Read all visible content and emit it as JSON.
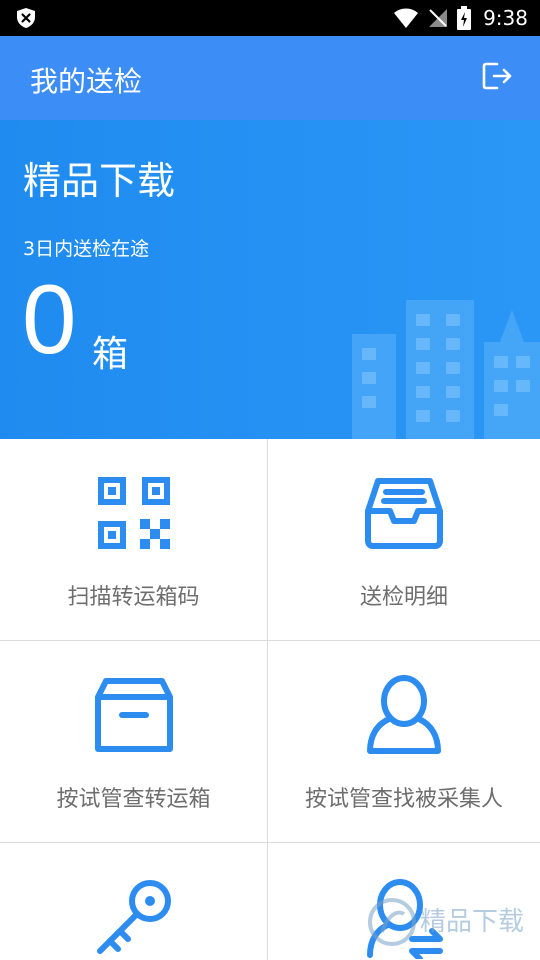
{
  "status_bar": {
    "time": "9:38"
  },
  "appbar": {
    "title": "我的送检"
  },
  "hero": {
    "brand": "精品下载",
    "subtitle": "3日内送检在途",
    "count": "0",
    "unit": "箱"
  },
  "menu": {
    "items": [
      {
        "label": "扫描转运箱码",
        "icon": "qr-code-icon"
      },
      {
        "label": "送检明细",
        "icon": "inbox-tray-icon"
      },
      {
        "label": "按试管查转运箱",
        "icon": "box-icon"
      },
      {
        "label": "按试管查找被采集人",
        "icon": "person-icon"
      },
      {
        "label": "",
        "icon": "key-icon"
      },
      {
        "label": "",
        "icon": "person-switch-icon"
      }
    ]
  },
  "watermark": {
    "text": "精品下载"
  },
  "colors": {
    "appbar": "#3d8df6",
    "hero": "#2590f3",
    "icon": "#2d8cf0",
    "label": "#6e6e6e"
  }
}
